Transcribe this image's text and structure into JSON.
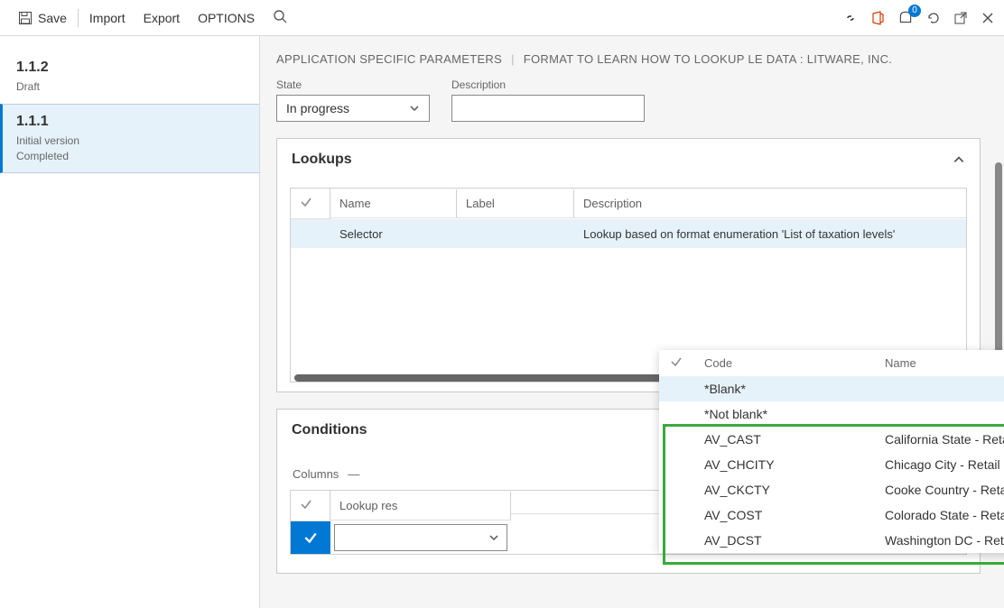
{
  "toolbar": {
    "save": "Save",
    "import": "Import",
    "export": "Export",
    "options": "OPTIONS",
    "badge_count": "0"
  },
  "sidebar": {
    "items": [
      {
        "version": "1.1.2",
        "line1": "Draft",
        "line2": ""
      },
      {
        "version": "1.1.1",
        "line1": "Initial version",
        "line2": "Completed"
      }
    ]
  },
  "breadcrumb": {
    "part1": "APPLICATION SPECIFIC PARAMETERS",
    "part2": "FORMAT TO LEARN HOW TO LOOKUP LE DATA : LITWARE, INC."
  },
  "form": {
    "state_label": "State",
    "state_value": "In progress",
    "desc_label": "Description",
    "desc_value": ""
  },
  "lookups_panel": {
    "title": "Lookups",
    "columns": {
      "name": "Name",
      "label": "Label",
      "desc": "Description"
    },
    "row": {
      "name": "Selector",
      "label": "",
      "desc": "Lookup based on format enumeration 'List of taxation levels'"
    }
  },
  "conditions_panel": {
    "title": "Conditions",
    "columns_label": "Columns",
    "col_lookup": "Lookup res",
    "input_value": ""
  },
  "popup": {
    "col_code": "Code",
    "col_name": "Name",
    "rows": [
      {
        "code": "*Blank*",
        "name": ""
      },
      {
        "code": "*Not blank*",
        "name": ""
      },
      {
        "code": "AV_CAST",
        "name": "California State - Retail Prod"
      },
      {
        "code": "AV_CHCITY",
        "name": "Chicago City - Retail Prod"
      },
      {
        "code": "AV_CKCTY",
        "name": "Cooke Country - Retail Prod"
      },
      {
        "code": "AV_COST",
        "name": "Colorado State - Retail Prod"
      },
      {
        "code": "AV_DCST",
        "name": "Washington DC - Retail Prod"
      }
    ]
  }
}
